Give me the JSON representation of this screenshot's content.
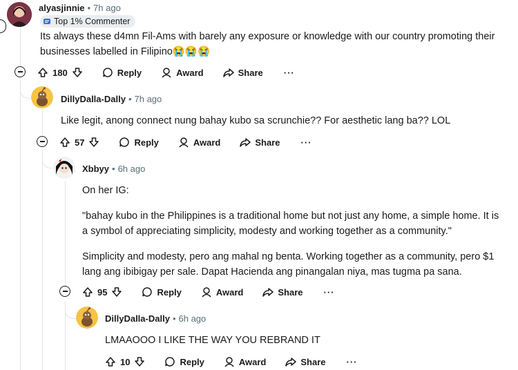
{
  "comments": [
    {
      "user": "alyasjinnie",
      "time": "7h ago",
      "badge": "Top 1% Commenter",
      "text": [
        "Its always these d4mn Fil-Ams with barely any exposure or knowledge with our country promoting their",
        "businesses labelled in Filipino"
      ],
      "emoji": "😭😭😭",
      "votes": "180",
      "reply": "Reply",
      "award": "Award",
      "share": "Share",
      "more": "···"
    },
    {
      "user": "DillyDalla-Dally",
      "time": "7h ago",
      "text": [
        "Like legit, anong connect nung bahay kubo sa scrunchie?? For aesthetic lang ba?? LOL"
      ],
      "votes": "57",
      "reply": "Reply",
      "award": "Award",
      "share": "Share",
      "more": "···"
    },
    {
      "user": "Xbbyy",
      "time": "6h ago",
      "paragraphs": [
        "On her IG:",
        "\"bahay kubo in the Philippines is a traditional home but not just any home, a simple home. It is a symbol of appreciating simplicity, modesty and working together as a community.\"",
        "Simplicity and modesty, pero ang mahal ng benta. Working together as a community, pero $1 lang ang ibibigay per sale. Dapat Hacienda ang pinangalan niya, mas tugma pa sana."
      ],
      "votes": "95",
      "reply": "Reply",
      "award": "Award",
      "share": "Share",
      "more": "···"
    },
    {
      "user": "DillyDalla-Dally",
      "time": "6h ago",
      "text": [
        "LMAAOOO I LIKE THE WAY YOU REBRAND IT"
      ],
      "votes": "10",
      "reply": "Reply",
      "award": "Award",
      "share": "Share",
      "more": "···"
    }
  ],
  "dot": "•",
  "colors": {
    "text": "#1a1a1b",
    "meta": "#576f76",
    "badge_bg": "#eaedef",
    "avatar_orange": "#f6c343"
  }
}
